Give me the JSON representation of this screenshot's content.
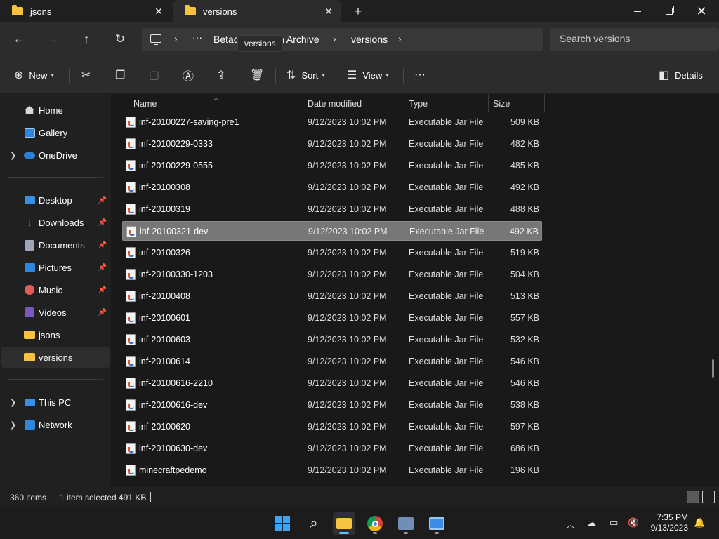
{
  "tabs": [
    {
      "label": "jsons"
    },
    {
      "label": "versions"
    }
  ],
  "tooltip": "versions",
  "breadcrumb": {
    "ellipsis": "···",
    "items": [
      "Betac",
      "n Archive",
      "versions"
    ]
  },
  "search": {
    "placeholder": "Search versions"
  },
  "toolbar": {
    "new_label": "New",
    "sort_label": "Sort",
    "view_label": "View",
    "more_label": "···",
    "details_label": "Details"
  },
  "sidebar": {
    "top": [
      {
        "label": "Home",
        "icon": "home-icon"
      },
      {
        "label": "Gallery",
        "icon": "gallery-icon"
      },
      {
        "label": "OneDrive",
        "icon": "onedrive-icon"
      }
    ],
    "pinned": [
      {
        "label": "Desktop",
        "icon": "desktop-icon"
      },
      {
        "label": "Downloads",
        "icon": "download-icon"
      },
      {
        "label": "Documents",
        "icon": "documents-icon"
      },
      {
        "label": "Pictures",
        "icon": "pictures-icon"
      },
      {
        "label": "Music",
        "icon": "music-icon"
      },
      {
        "label": "Videos",
        "icon": "videos-icon"
      },
      {
        "label": "jsons",
        "icon": "folder-icon"
      },
      {
        "label": "versions",
        "icon": "folder-icon"
      }
    ],
    "bottom": [
      {
        "label": "This PC",
        "icon": "this-pc-icon"
      },
      {
        "label": "Network",
        "icon": "network-icon"
      }
    ]
  },
  "columns": {
    "name": "Name",
    "date": "Date modified",
    "type": "Type",
    "size": "Size"
  },
  "files": [
    {
      "name": "inf-20100227-saving-pre1",
      "date": "9/12/2023 10:02 PM",
      "type": "Executable Jar File",
      "size": "509 KB"
    },
    {
      "name": "inf-20100229-0333",
      "date": "9/12/2023 10:02 PM",
      "type": "Executable Jar File",
      "size": "482 KB"
    },
    {
      "name": "inf-20100229-0555",
      "date": "9/12/2023 10:02 PM",
      "type": "Executable Jar File",
      "size": "485 KB"
    },
    {
      "name": "inf-20100308",
      "date": "9/12/2023 10:02 PM",
      "type": "Executable Jar File",
      "size": "492 KB"
    },
    {
      "name": "inf-20100319",
      "date": "9/12/2023 10:02 PM",
      "type": "Executable Jar File",
      "size": "488 KB"
    },
    {
      "name": "inf-20100321-dev",
      "date": "9/12/2023 10:02 PM",
      "type": "Executable Jar File",
      "size": "492 KB"
    },
    {
      "name": "inf-20100326",
      "date": "9/12/2023 10:02 PM",
      "type": "Executable Jar File",
      "size": "519 KB"
    },
    {
      "name": "inf-20100330-1203",
      "date": "9/12/2023 10:02 PM",
      "type": "Executable Jar File",
      "size": "504 KB"
    },
    {
      "name": "inf-20100408",
      "date": "9/12/2023 10:02 PM",
      "type": "Executable Jar File",
      "size": "513 KB"
    },
    {
      "name": "inf-20100601",
      "date": "9/12/2023 10:02 PM",
      "type": "Executable Jar File",
      "size": "557 KB"
    },
    {
      "name": "inf-20100603",
      "date": "9/12/2023 10:02 PM",
      "type": "Executable Jar File",
      "size": "532 KB"
    },
    {
      "name": "inf-20100614",
      "date": "9/12/2023 10:02 PM",
      "type": "Executable Jar File",
      "size": "546 KB"
    },
    {
      "name": "inf-20100616-2210",
      "date": "9/12/2023 10:02 PM",
      "type": "Executable Jar File",
      "size": "546 KB"
    },
    {
      "name": "inf-20100616-dev",
      "date": "9/12/2023 10:02 PM",
      "type": "Executable Jar File",
      "size": "538 KB"
    },
    {
      "name": "inf-20100620",
      "date": "9/12/2023 10:02 PM",
      "type": "Executable Jar File",
      "size": "597 KB"
    },
    {
      "name": "inf-20100630-dev",
      "date": "9/12/2023 10:02 PM",
      "type": "Executable Jar File",
      "size": "686 KB"
    },
    {
      "name": "minecraftpedemo",
      "date": "9/12/2023 10:02 PM",
      "type": "Executable Jar File",
      "size": "196 KB"
    }
  ],
  "selected_index": 5,
  "status": {
    "item_count": "360 items",
    "selection": "1 item selected",
    "selection_size": "491 KB"
  },
  "clock": {
    "time": "7:35 PM",
    "date": "9/13/2023"
  },
  "colors": {
    "accent": "#5ec2ff",
    "folder": "#f5c242",
    "selected_row": "#777777"
  }
}
